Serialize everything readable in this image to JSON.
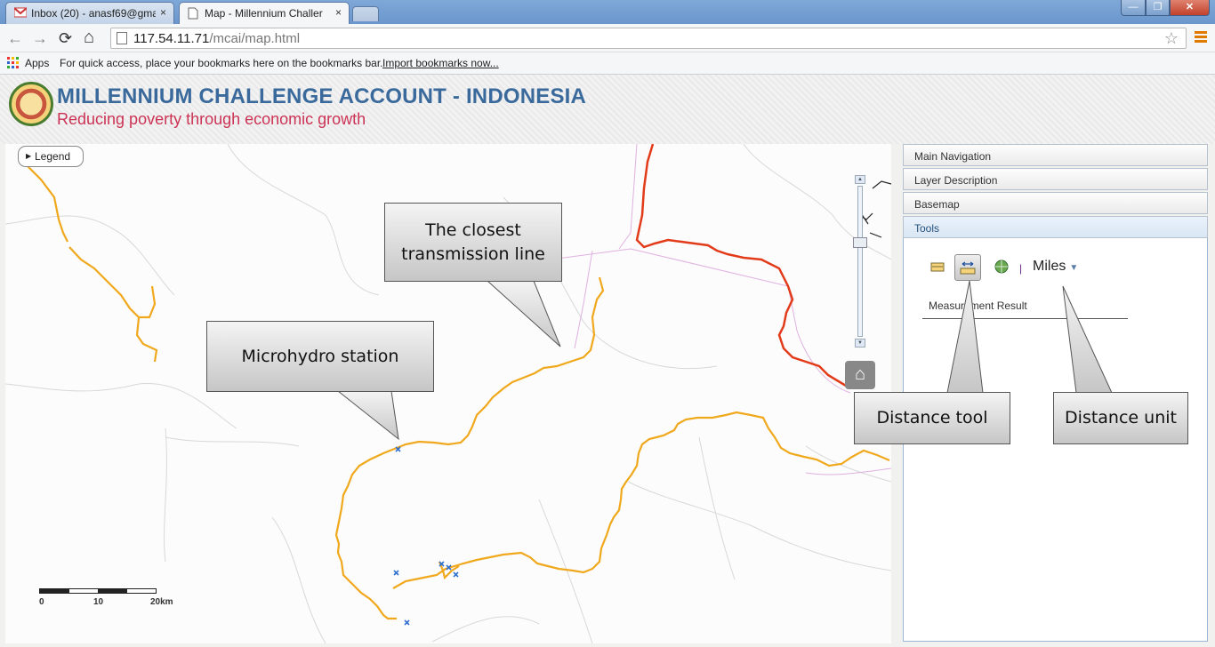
{
  "browser": {
    "tabs": [
      {
        "title": "Inbox (20) - anasf69@gma",
        "close": "×"
      },
      {
        "title": "Map - Millennium Challer",
        "close": "×"
      }
    ],
    "window_buttons": {
      "minimize": "—",
      "maximize": "❐",
      "close": "✕"
    },
    "nav": {
      "back": "←",
      "forward": "→",
      "reload": "⟳",
      "home": "⌂"
    },
    "url_host": "117.54.11.71",
    "url_path": "/mcai/map.html",
    "star": "☆",
    "bookmarks": {
      "apps_label": "Apps",
      "message": "For quick access, place your bookmarks here on the bookmarks bar.",
      "link": "Import bookmarks now..."
    }
  },
  "header": {
    "title": "MILLENNIUM CHALLENGE ACCOUNT - INDONESIA",
    "subtitle": "Reducing poverty through economic growth"
  },
  "map": {
    "legend_label": "Legend",
    "scale_labels": [
      "0",
      "10",
      "20km"
    ],
    "home_icon": "⌂",
    "zoom_up": "▲",
    "zoom_down": "▼"
  },
  "callouts": {
    "transmission": "The closest transmission line",
    "microhydro": "Microhydro station",
    "distance_tool": "Distance tool",
    "distance_unit": "Distance unit"
  },
  "panel": {
    "sections": [
      "Main Navigation",
      "Layer Description",
      "Basemap",
      "Tools"
    ],
    "unit_separator": "|",
    "unit_value": "Miles",
    "unit_caret": "▼",
    "result_label": "Measurement Result"
  },
  "colors": {
    "road": "#f0a81c",
    "transmission_line": "#e23b1a",
    "boundary": "#d9a6d9",
    "station_marker": "#3070d0",
    "title_blue": "#3a6a9c",
    "subtitle_red": "#cc3355"
  }
}
